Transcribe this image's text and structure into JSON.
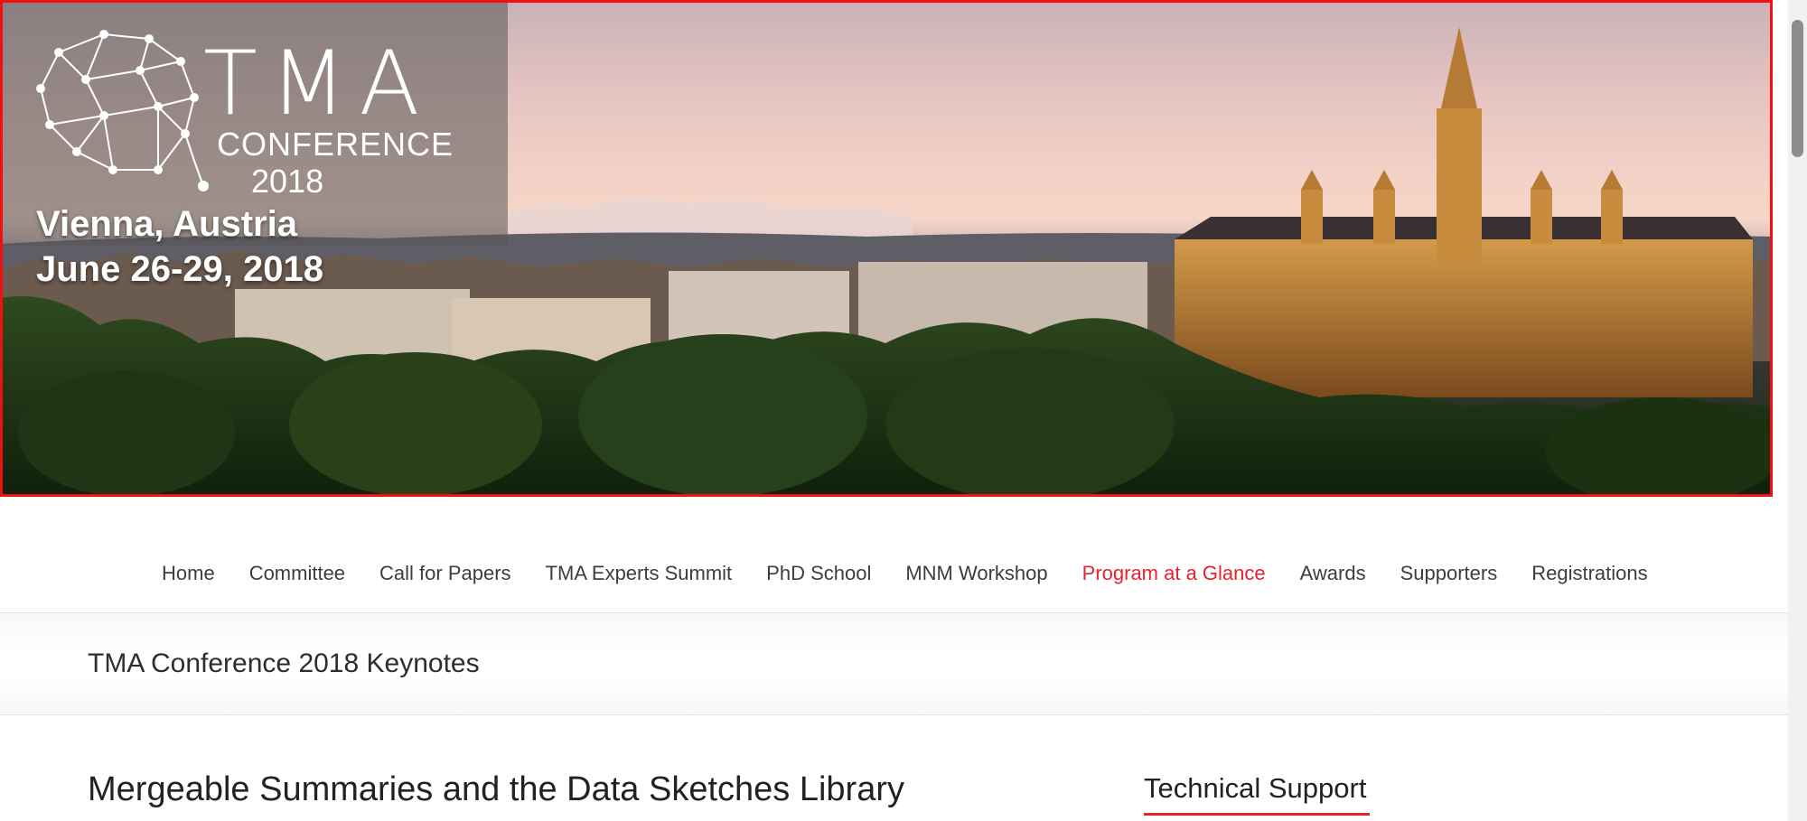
{
  "banner": {
    "logo_word": "TMA",
    "logo_conference": "CONFERENCE",
    "logo_year": "2018",
    "city": "Vienna, Austria",
    "dates": "June 26-29, 2018"
  },
  "nav": {
    "items": [
      {
        "label": "Home"
      },
      {
        "label": "Committee"
      },
      {
        "label": "Call for Papers"
      },
      {
        "label": "TMA Experts Summit"
      },
      {
        "label": "PhD School"
      },
      {
        "label": "MNM Workshop"
      },
      {
        "label": "Program at a Glance",
        "active": true
      },
      {
        "label": "Awards"
      },
      {
        "label": "Supporters"
      },
      {
        "label": "Registrations"
      }
    ]
  },
  "page": {
    "title": "TMA Conference 2018 Keynotes"
  },
  "content": {
    "heading": "Mergeable Summaries and the Data Sketches Library"
  },
  "sidebar": {
    "heading": "Technical Support"
  },
  "colors": {
    "accent": "#e8222e",
    "nav_text": "#3d3d3d",
    "banner_border": "#f10f0f"
  }
}
